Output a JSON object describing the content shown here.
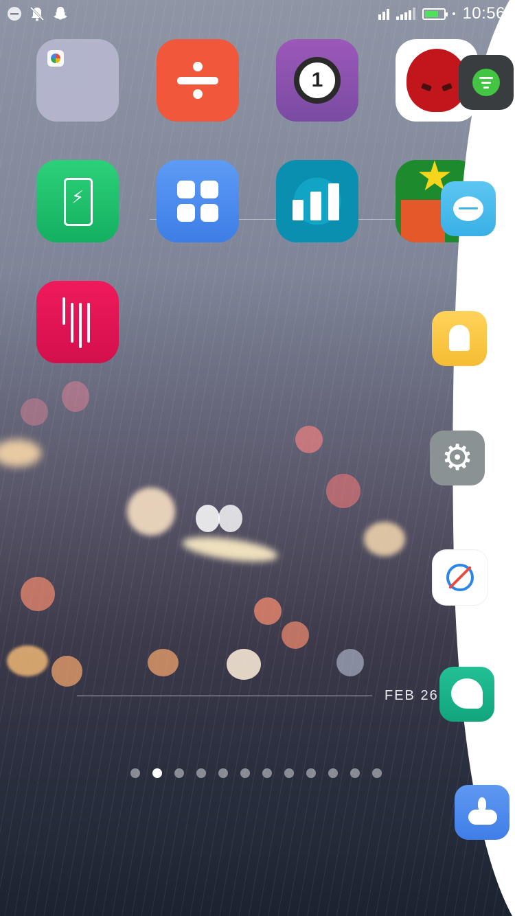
{
  "status_bar": {
    "left_icons": [
      "minus-circle-icon",
      "notifications-off-icon",
      "snapchat-ghost-icon"
    ],
    "time": "10:56",
    "battery_level": 0.62,
    "battery_color": "#4ee25a"
  },
  "home_apps": [
    {
      "name": "app-folder",
      "icon": "folder-icon"
    },
    {
      "name": "calculator-app",
      "icon": "divide-icon"
    },
    {
      "name": "one-password-app",
      "icon": "one-circle-icon",
      "glyph": "1"
    },
    {
      "name": "antutu-app",
      "icon": "antutu-rabbit-icon"
    },
    {
      "name": "battery-app",
      "icon": "battery-charging-icon",
      "glyph": "⚡"
    },
    {
      "name": "app-store-app",
      "icon": "grid-squares-icon"
    },
    {
      "name": "stats-app",
      "icon": "bar-chart-icon"
    },
    {
      "name": "appgratis-app",
      "icon": "gift-star-icon"
    },
    {
      "name": "audio-app",
      "icon": "sound-wave-icon"
    }
  ],
  "date_widget": {
    "label": "FEB 26"
  },
  "pagination": {
    "total": 12,
    "active_index": 1
  },
  "edge_panel": {
    "apps": [
      {
        "name": "filter-app",
        "icon": "filter-icon"
      },
      {
        "name": "chat-app",
        "icon": "chat-bubble-icon"
      },
      {
        "name": "ghost-notes-app",
        "icon": "ghost-icon"
      },
      {
        "name": "settings-app",
        "icon": "gear-icon",
        "glyph": "⚙"
      },
      {
        "name": "browser-app",
        "icon": "compass-icon"
      },
      {
        "name": "messages-app",
        "icon": "message-bubble-icon"
      },
      {
        "name": "weather-app",
        "icon": "cloud-drop-icon"
      }
    ]
  }
}
